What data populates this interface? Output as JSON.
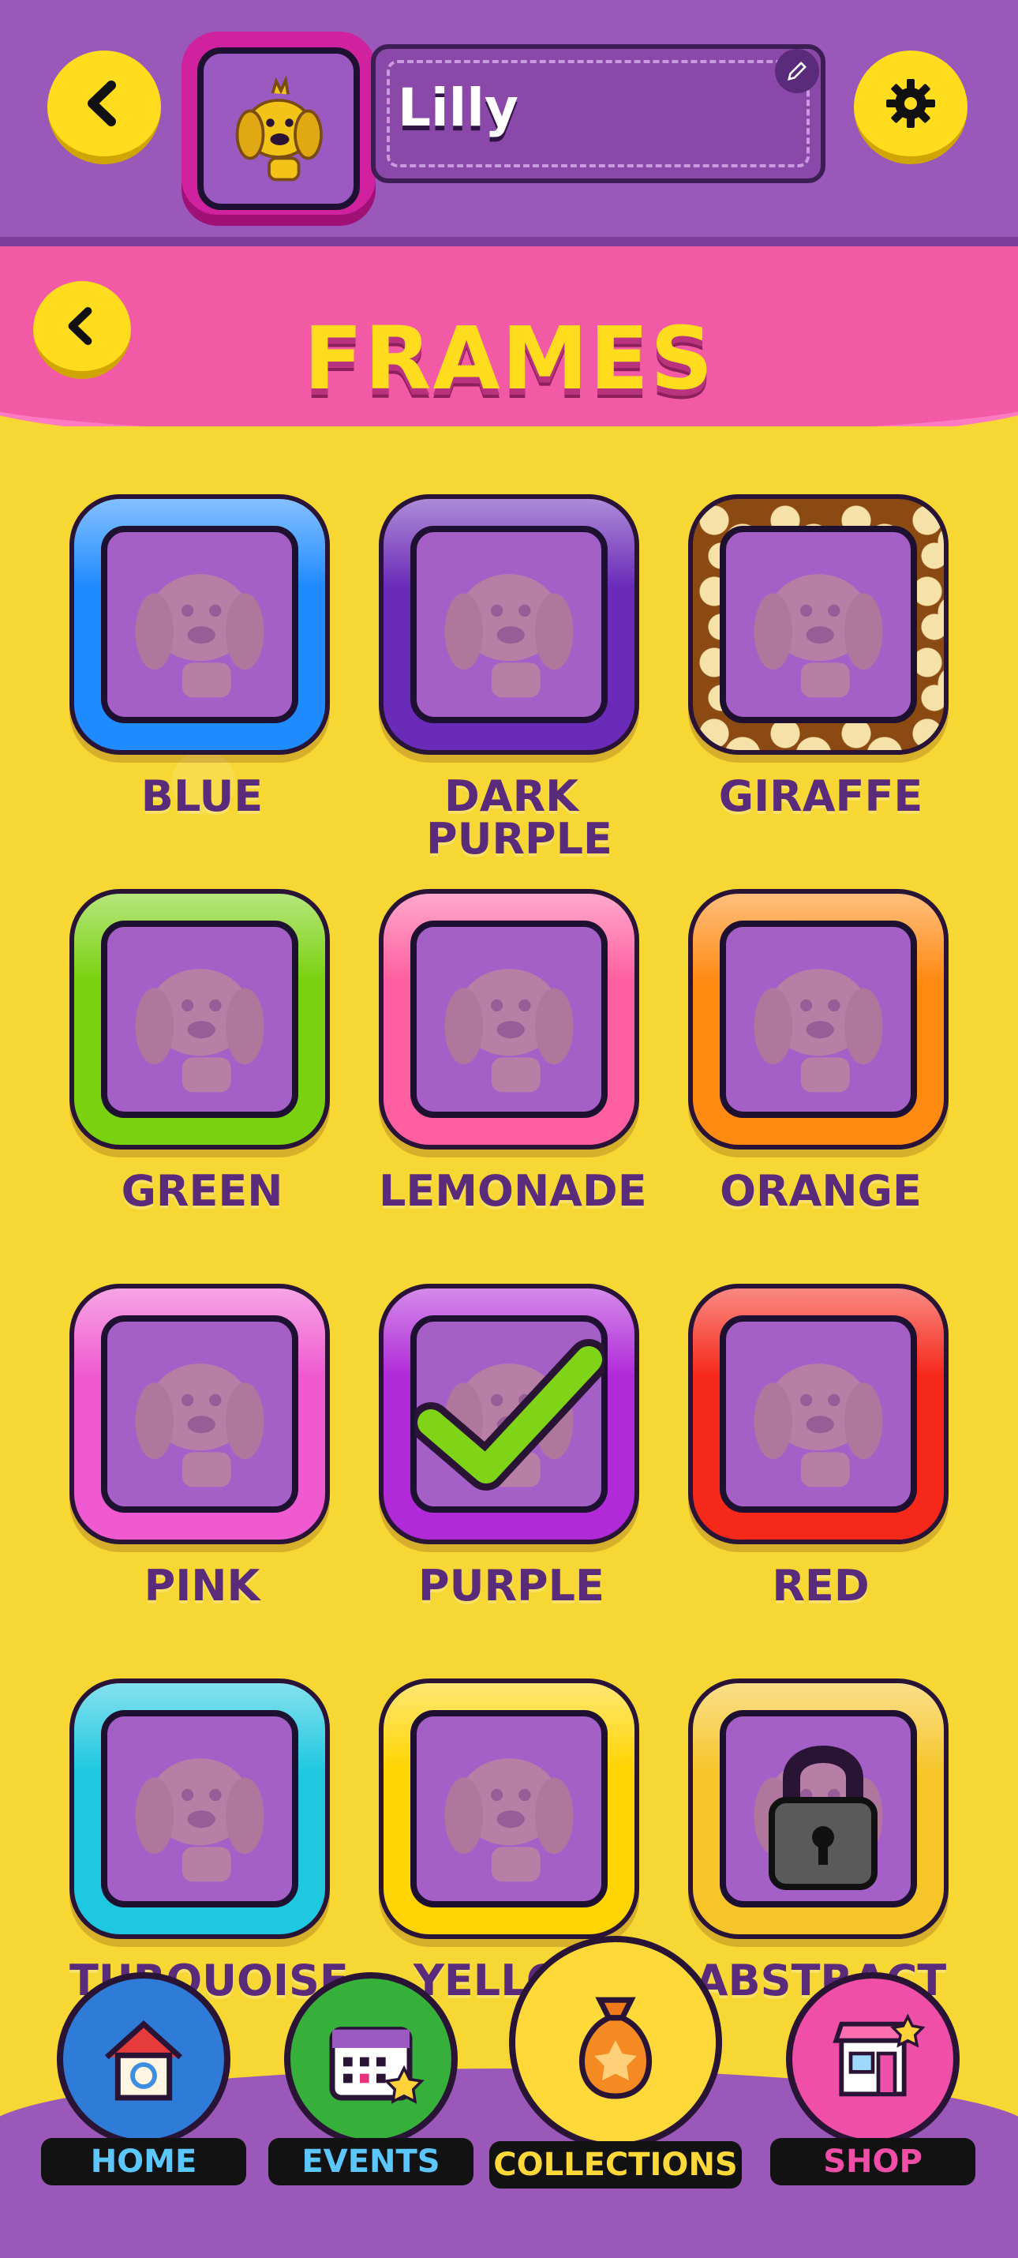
{
  "header": {
    "player_name": "Lilly",
    "back_icon": "chevron-left-icon",
    "settings_icon": "gear-icon",
    "edit_icon": "pencil-icon"
  },
  "section": {
    "title": "FRAMES",
    "back_icon": "chevron-left-icon"
  },
  "frames": [
    {
      "label": "BLUE",
      "color": "#1f8bff",
      "status": ""
    },
    {
      "label": "DARK PURPLE",
      "color": "#6a2bb8",
      "status": ""
    },
    {
      "label": "GIRAFFE",
      "color": "#8a4a12",
      "status": ""
    },
    {
      "label": "GREEN",
      "color": "#79d10f",
      "status": ""
    },
    {
      "label": "LEMONADE",
      "color": "#ff5fa0",
      "status": ""
    },
    {
      "label": "ORANGE",
      "color": "#ff8a12",
      "status": ""
    },
    {
      "label": "PINK",
      "color": "#f05ad0",
      "status": ""
    },
    {
      "label": "PURPLE",
      "color": "#b02ad8",
      "status": "selected"
    },
    {
      "label": "RED",
      "color": "#f5281a",
      "status": ""
    },
    {
      "label": "TURQUOISE",
      "color": "#1fc8e0",
      "status": ""
    },
    {
      "label": "YELLOW",
      "color": "#ffd400",
      "status": ""
    },
    {
      "label": "ABSTRACT",
      "color": "#f6c52a",
      "status": "locked"
    }
  ],
  "nav": {
    "home": {
      "label": "HOME",
      "icon": "house-icon",
      "color": "#2e7bd8"
    },
    "events": {
      "label": "EVENTS",
      "icon": "calendar-icon",
      "color": "#36b03a"
    },
    "collections": {
      "label": "COLLECTIONS",
      "icon": "money-bag-icon",
      "color": "#ffd83a",
      "active": true
    },
    "shop": {
      "label": "SHOP",
      "icon": "shop-icon",
      "color": "#ef4fa6"
    }
  }
}
